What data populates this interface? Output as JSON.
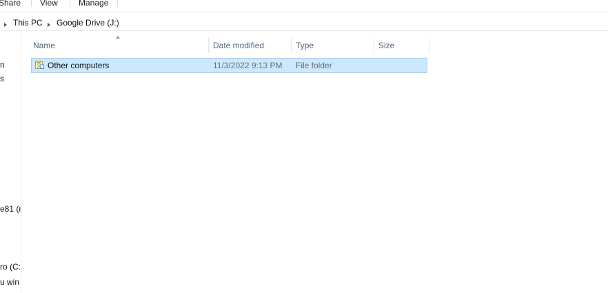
{
  "ribbon": {
    "tabs": [
      "Share",
      "View",
      "Manage"
    ]
  },
  "address_bar": {
    "segments": [
      "This PC",
      "Google Drive (J:)"
    ]
  },
  "nav_pane": {
    "fragments": [
      "n",
      "s",
      "e81 (n",
      "ro (C:",
      "u  win"
    ]
  },
  "file_list": {
    "columns": [
      "Name",
      "Date modified",
      "Type",
      "Size"
    ],
    "sort_column": "Name",
    "rows": [
      {
        "name": "Other computers",
        "date_modified": "11/3/2022 9:13 PM",
        "type": "File folder",
        "size": "",
        "icon": "folder-icon",
        "selected": true
      }
    ]
  },
  "colors": {
    "selection_fill": "#cce8ff",
    "selection_border": "#99d1ff",
    "header_text": "#4c607a",
    "meta_text": "#6d6d6d"
  }
}
